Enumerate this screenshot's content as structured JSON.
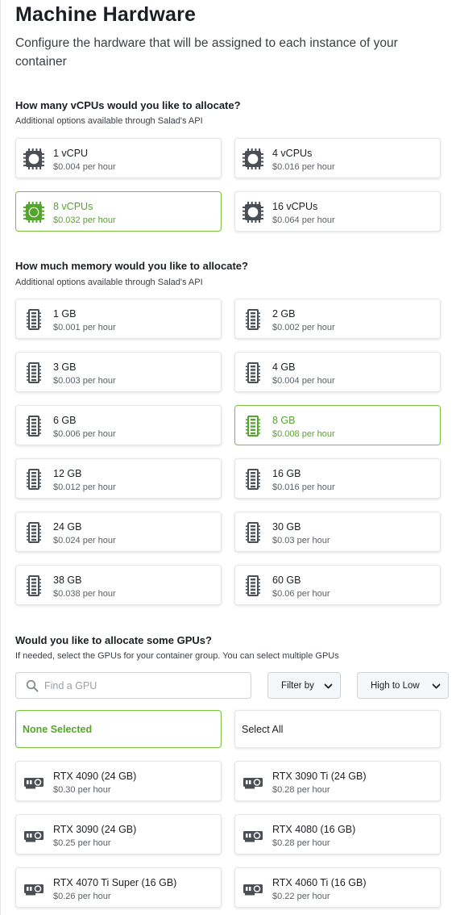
{
  "header": {
    "title": "Machine Hardware",
    "subtitle": "Configure the hardware that will be assigned to each instance of your container"
  },
  "vcpu": {
    "question": "How many vCPUs would you like to allocate?",
    "note": "Additional options available through Salad's API",
    "options": [
      {
        "label": "1 vCPU",
        "price": "$0.004 per hour",
        "selected": false
      },
      {
        "label": "4 vCPUs",
        "price": "$0.016 per hour",
        "selected": false
      },
      {
        "label": "8 vCPUs",
        "price": "$0.032 per hour",
        "selected": true
      },
      {
        "label": "16 vCPUs",
        "price": "$0.064 per hour",
        "selected": false
      }
    ]
  },
  "memory": {
    "question": "How much memory would you like to allocate?",
    "note": "Additional options available through Salad's API",
    "options": [
      {
        "label": "1 GB",
        "price": "$0.001 per hour",
        "selected": false
      },
      {
        "label": "2 GB",
        "price": "$0.002 per hour",
        "selected": false
      },
      {
        "label": "3 GB",
        "price": "$0.003 per hour",
        "selected": false
      },
      {
        "label": "4 GB",
        "price": "$0.004 per hour",
        "selected": false
      },
      {
        "label": "6 GB",
        "price": "$0.006 per hour",
        "selected": false
      },
      {
        "label": "8 GB",
        "price": "$0.008 per hour",
        "selected": true
      },
      {
        "label": "12 GB",
        "price": "$0.012 per hour",
        "selected": false
      },
      {
        "label": "16 GB",
        "price": "$0.016 per hour",
        "selected": false
      },
      {
        "label": "24 GB",
        "price": "$0.024 per hour",
        "selected": false
      },
      {
        "label": "30 GB",
        "price": "$0.03 per hour",
        "selected": false
      },
      {
        "label": "38 GB",
        "price": "$0.038 per hour",
        "selected": false
      },
      {
        "label": "60 GB",
        "price": "$0.06 per hour",
        "selected": false
      }
    ]
  },
  "gpu": {
    "question": "Would you like to allocate some GPUs?",
    "note": "If needed, select the GPUs for your container group. You can select multiple GPUs",
    "search_placeholder": "Find a GPU",
    "filter_label": "Filter by",
    "sort_label": "High to Low",
    "none_label": "None Selected",
    "all_label": "Select All",
    "options": [
      {
        "label": "RTX 4090 (24 GB)",
        "price": "$0.30 per hour"
      },
      {
        "label": "RTX 3090 Ti (24 GB)",
        "price": "$0.28 per hour"
      },
      {
        "label": "RTX 3090 (24 GB)",
        "price": "$0.25 per hour"
      },
      {
        "label": "RTX 4080 (16 GB)",
        "price": "$0.28 per hour"
      },
      {
        "label": "RTX 4070 Ti Super (16 GB)",
        "price": "$0.26 per hour"
      },
      {
        "label": "RTX 4060 Ti (16 GB)",
        "price": "$0.22 per hour"
      }
    ]
  },
  "icons": {
    "cpu": "cpu-chip-icon",
    "memory": "memory-module-icon",
    "gpu": "gpu-card-icon",
    "search": "search-icon",
    "chevron": "chevron-down-icon"
  },
  "colors": {
    "accent": "#53a62a",
    "accent_border": "#78c13b",
    "icon_gray": "#4a4f55"
  }
}
